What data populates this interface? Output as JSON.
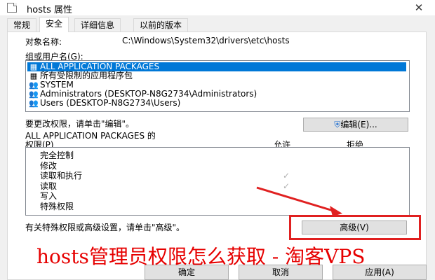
{
  "window": {
    "title": "hosts 属性",
    "close_icon": "close-icon"
  },
  "tabs": [
    {
      "label": "常规",
      "active": false
    },
    {
      "label": "安全",
      "active": true
    },
    {
      "label": "详细信息",
      "active": false
    },
    {
      "label": "以前的版本",
      "active": false
    }
  ],
  "security": {
    "object_name_label": "对象名称:",
    "object_name_value": "C:\\Windows\\System32\\drivers\\etc\\hosts",
    "groups_label": "组或用户名(G):",
    "groups": [
      {
        "icon": "package-group-icon",
        "name": "ALL APPLICATION PACKAGES",
        "selected": true
      },
      {
        "icon": "restricted-package-icon",
        "name": "所有受限制的应用程序包",
        "selected": false
      },
      {
        "icon": "users-icon",
        "name": "SYSTEM",
        "selected": false
      },
      {
        "icon": "users-icon",
        "name": "Administrators (DESKTOP-N8G2734\\Administrators)",
        "selected": false
      },
      {
        "icon": "users-icon",
        "name": "Users (DESKTOP-N8G2734\\Users)",
        "selected": false
      }
    ],
    "change_perm_text": "要更改权限，请单击\"编辑\"。",
    "edit_button": "编辑(E)...",
    "perm_for_label_1": "ALL APPLICATION PACKAGES 的",
    "perm_for_label_2": "权限(P)",
    "allow_header": "允许",
    "deny_header": "拒绝",
    "permissions": [
      {
        "name": "完全控制",
        "allow": false
      },
      {
        "name": "修改",
        "allow": false
      },
      {
        "name": "读取和执行",
        "allow": true
      },
      {
        "name": "读取",
        "allow": true
      },
      {
        "name": "写入",
        "allow": false
      },
      {
        "name": "特殊权限",
        "allow": false
      }
    ],
    "check_mark": "✓",
    "advanced_text": "有关特殊权限或高级设置，请单击\"高级\"。",
    "advanced_button": "高级(V)"
  },
  "footer": {
    "ok_button": "确定",
    "cancel_button": "取消",
    "apply_button": "应用(A)"
  },
  "overlay": {
    "caption": "hosts管理员权限怎么获取 - 淘客VPS",
    "caption_color": "#e60000",
    "highlight_color": "#e02020"
  }
}
